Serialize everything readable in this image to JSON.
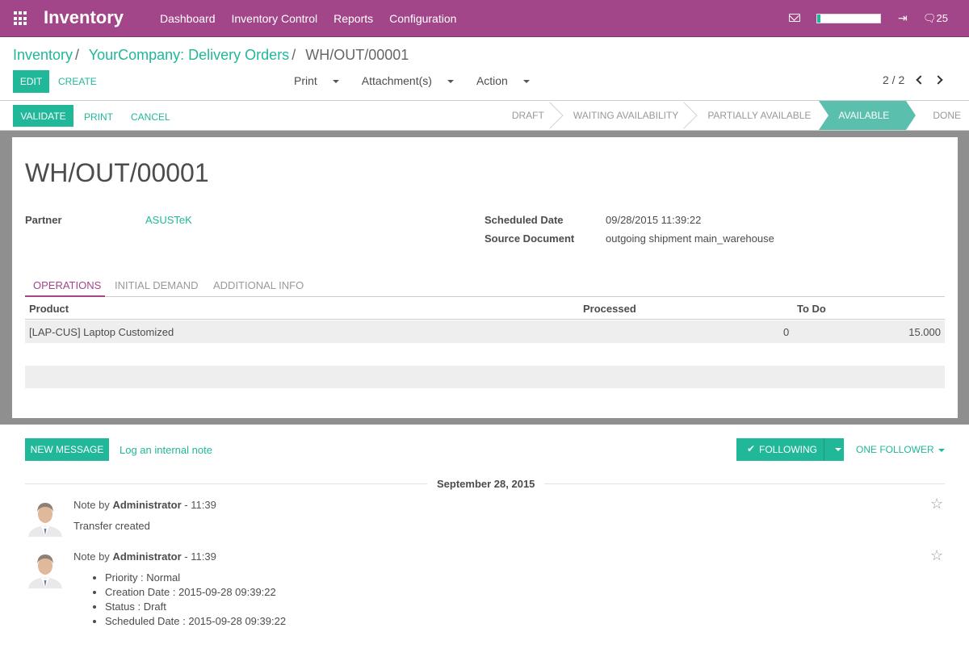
{
  "navbar": {
    "brand": "Inventory",
    "menu": [
      "Dashboard",
      "Inventory Control",
      "Reports",
      "Configuration"
    ],
    "chat_count": "25",
    "progress": 0.05,
    "icons": [
      "apps-grid-icon",
      "mail-icon",
      "logout-icon",
      "chat-icon"
    ]
  },
  "breadcrumb": {
    "root": "Inventory",
    "parent": "YourCompany: Delivery Orders",
    "current": "WH/OUT/00001",
    "sep": "/"
  },
  "controlpanel": {
    "edit": "EDIT",
    "create": "CREATE",
    "print": "Print",
    "attachments": "Attachment(s)",
    "action": "Action",
    "pager": "2 / 2"
  },
  "statusbar": {
    "validate": "VALIDATE",
    "print": "PRINT",
    "cancel": "CANCEL",
    "stages": [
      "DRAFT",
      "WAITING AVAILABILITY",
      "PARTIALLY AVAILABLE",
      "AVAILABLE",
      "DONE"
    ],
    "active_stage": "AVAILABLE"
  },
  "form": {
    "title": "WH/OUT/00001",
    "partner_label": "Partner",
    "partner_value": "ASUSTeK",
    "scheduled_label": "Scheduled Date",
    "scheduled_value": "09/28/2015 11:39:22",
    "source_label": "Source Document",
    "source_value": "outgoing shipment main_warehouse",
    "tabs": [
      "OPERATIONS",
      "INITIAL DEMAND",
      "ADDITIONAL INFO"
    ],
    "columns": [
      "Product",
      "Processed",
      "To Do"
    ],
    "rows": [
      {
        "product": "[LAP-CUS] Laptop Customized",
        "processed": "0",
        "todo": "15.000"
      }
    ]
  },
  "chatter": {
    "new_message": "NEW MESSAGE",
    "log_note": "Log an internal note",
    "following": "FOLLOWING",
    "followers": "ONE FOLLOWER",
    "date": "September 28, 2015",
    "messages": [
      {
        "prefix": "Note by",
        "author": "Administrator",
        "time": "- 11:39",
        "body": "Transfer created"
      },
      {
        "prefix": "Note by",
        "author": "Administrator",
        "time": "- 11:39",
        "items": [
          "Priority : Normal",
          "Creation Date : 2015-09-28 09:39:22",
          "Status : Draft",
          "Scheduled Date : 2015-09-28 09:39:22"
        ]
      }
    ]
  },
  "colors": {
    "navbar": "#a24689",
    "accent": "#21b799",
    "active_stage": "#5bbfae"
  }
}
